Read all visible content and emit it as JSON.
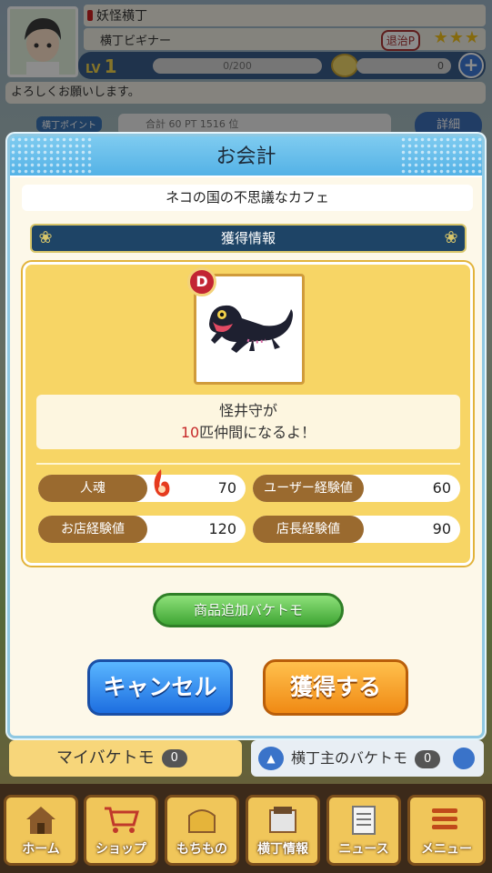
{
  "header": {
    "user_name": "妖怪横丁",
    "user_title": "横丁ビギナー",
    "rank_badge": "退治P",
    "stars": "★★★",
    "level_label": "LV",
    "level": "1",
    "exp": "0/200",
    "coins": "0",
    "greeting": "よろしくお願いします。",
    "points_label": "横丁ポイント",
    "points_value": "合計 60 PT 1516 位",
    "details_button": "詳細"
  },
  "modal": {
    "title": "お会計",
    "shop_name": "ネコの国の不思議なカフェ",
    "section_title": "獲得情報",
    "monster_rank": "D",
    "message_line1": "怪井守が",
    "message_count": "10",
    "message_line2": "匹仲間になるよ！",
    "stats": [
      {
        "label": "人魂",
        "value": "70"
      },
      {
        "label": "ユーザー経験値",
        "value": "60"
      },
      {
        "label": "お店経験値",
        "value": "120"
      },
      {
        "label": "店長経験値",
        "value": "90"
      }
    ],
    "add_button": "商品追加バケトモ",
    "cancel_button": "キャンセル",
    "obtain_button": "獲得する"
  },
  "tabs": {
    "my_baketomo": "マイバケトモ",
    "my_count": "0",
    "yokocho_baketomo": "横丁主のバケトモ",
    "yokocho_count": "0"
  },
  "nav": [
    {
      "label": "ホーム",
      "icon": "home-icon"
    },
    {
      "label": "ショップ",
      "icon": "cart-icon"
    },
    {
      "label": "もちもの",
      "icon": "bag-icon"
    },
    {
      "label": "横丁情報",
      "icon": "info-icon"
    },
    {
      "label": "ニュース",
      "icon": "news-icon"
    },
    {
      "label": "メニュー",
      "icon": "menu-icon"
    }
  ],
  "colors": {
    "modal_header": "#54b2e6",
    "reward_card": "#f7d565",
    "cancel": "#1d6ee0",
    "obtain": "#f08a14",
    "highlight_number": "#c62828"
  }
}
